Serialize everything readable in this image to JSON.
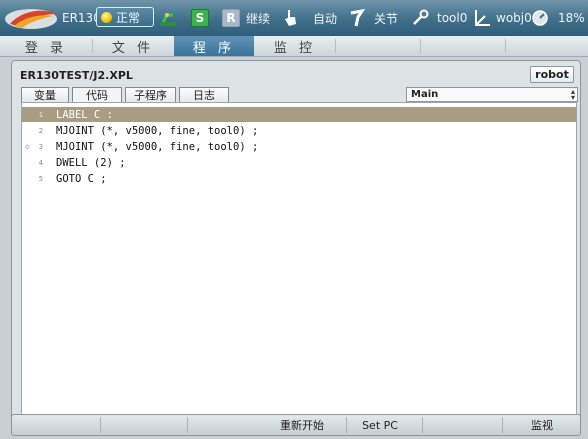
{
  "topbar": {
    "controller": "ER130",
    "status": "正常",
    "s_label": "S",
    "r_label": "R",
    "continue": "继续",
    "mode": "自动",
    "joint": "关节",
    "tool": "tool0",
    "wobj": "wobj0",
    "speed": "18%",
    "colors": {
      "bar": "#3f6f8a",
      "status_dot": "#f2c200",
      "s_button": "#3ab34a"
    },
    "icons": [
      "brand-logo-icon",
      "status-dot-icon",
      "robot-arm-icon",
      "hand-icon",
      "joint-icon",
      "wrench-icon",
      "coordinate-axes-icon",
      "speed-gauge-icon"
    ]
  },
  "menu": {
    "tabs": [
      "登 录",
      "文 件",
      "程 序",
      "监 控"
    ],
    "active": "程 序"
  },
  "panel": {
    "file_path": "ER130TEST/J2.XPL",
    "robot_button": "robot",
    "subtabs": [
      "变量",
      "代码",
      "子程序",
      "日志"
    ],
    "active_subtab": "代码",
    "routine_select": "Main"
  },
  "code": [
    {
      "n": "1",
      "text": "LABEL C :"
    },
    {
      "n": "2",
      "text": "MJOINT (*, v5000, fine, tool0) ;"
    },
    {
      "n": "3",
      "text": "MJOINT (*, v5000, fine, tool0) ;"
    },
    {
      "n": "4",
      "text": "DWELL (2) ;"
    },
    {
      "n": "5",
      "text": "GOTO C ;"
    }
  ],
  "selected_line": "1",
  "program_pointer_line": "3",
  "bottom": {
    "restart": "重新开始",
    "set_pc": "Set PC",
    "monitor": "监视"
  }
}
